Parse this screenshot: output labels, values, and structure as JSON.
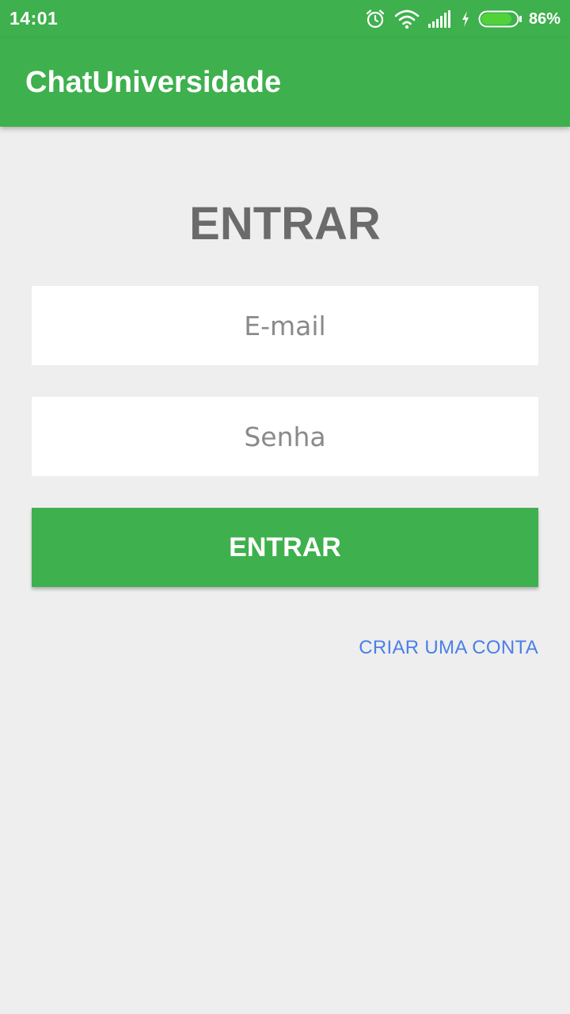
{
  "status_bar": {
    "time": "14:01",
    "battery_percent": "86%",
    "icons": [
      "alarm-icon",
      "wifi-icon",
      "signal-icon",
      "charging-icon",
      "battery-icon"
    ],
    "battery_level": 0.86
  },
  "app_bar": {
    "title": "ChatUniversidade"
  },
  "login": {
    "heading": "ENTRAR",
    "email_placeholder": "E-mail",
    "password_placeholder": "Senha",
    "submit_label": "ENTRAR",
    "create_account_label": "CRIAR UMA CONTA"
  },
  "colors": {
    "primary": "#3eb04d",
    "background": "#eeeeee",
    "heading_text": "#6b6b6b",
    "link": "#4a7fe8"
  }
}
